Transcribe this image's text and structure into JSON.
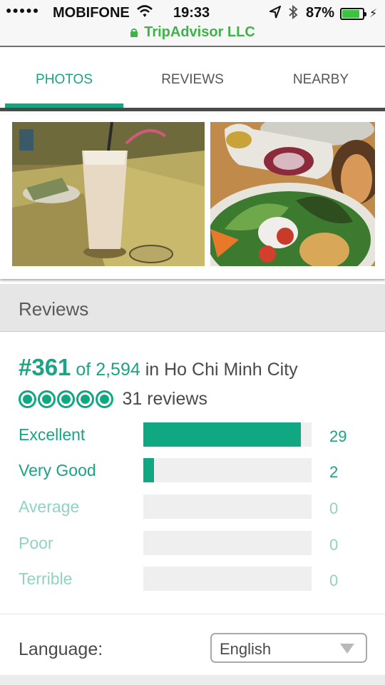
{
  "status_bar": {
    "signal_dots": "●●●●●",
    "carrier": "MOBIFONE",
    "time": "19:33",
    "battery": "87%",
    "battery_level": 0.87,
    "url": "TripAdvisor LLC",
    "icons": [
      "wifi-icon",
      "location-arrow-icon",
      "bluetooth-icon",
      "battery-icon",
      "charging-bolt-icon",
      "lock-icon"
    ]
  },
  "tabs": [
    {
      "label": "PHOTOS",
      "active": true
    },
    {
      "label": "REVIEWS",
      "active": false
    },
    {
      "label": "NEARBY",
      "active": false
    }
  ],
  "photos": [
    {
      "alt": "milkshake-photo"
    },
    {
      "alt": "food-platter-photo"
    }
  ],
  "reviews_section": {
    "title": "Reviews",
    "rank_number": "#361",
    "rank_of": "of",
    "rank_total": "2,594",
    "rank_location": "in Ho Chi Minh City",
    "bubble_rating": 5,
    "review_count": "31 reviews",
    "ratings": [
      {
        "label": "Excellent",
        "count": "29",
        "fraction": 0.935,
        "active": true
      },
      {
        "label": "Very Good",
        "count": "2",
        "fraction": 0.065,
        "active": true
      },
      {
        "label": "Average",
        "count": "0",
        "fraction": 0,
        "active": false
      },
      {
        "label": "Poor",
        "count": "0",
        "fraction": 0,
        "active": false
      },
      {
        "label": "Terrible",
        "count": "0",
        "fraction": 0,
        "active": false
      }
    ]
  },
  "language": {
    "label": "Language:",
    "selected": "English"
  },
  "colors": {
    "accent": "#0fa882",
    "accent_text": "#1aa384",
    "muted_accent": "#8fd3c2",
    "url_green": "#3fb24a"
  }
}
